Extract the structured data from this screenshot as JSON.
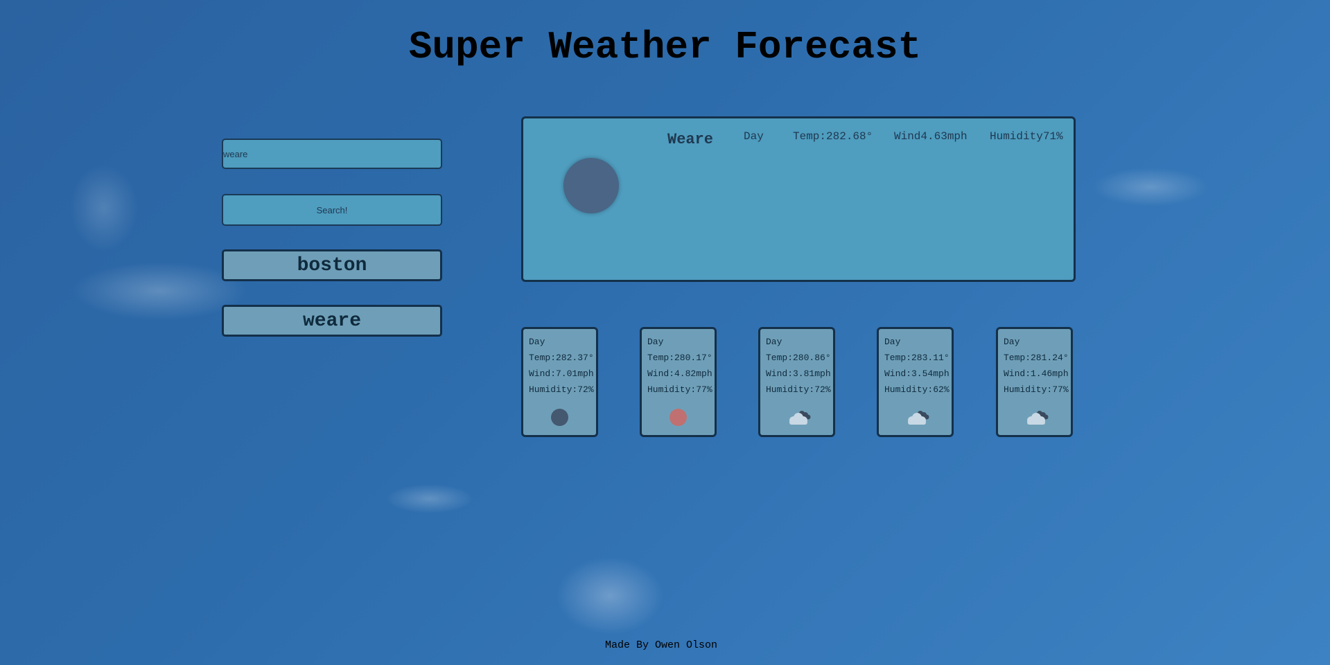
{
  "header": {
    "title": "Super Weather Forecast"
  },
  "search": {
    "value": "weare",
    "button_label": "Search!"
  },
  "history": [
    {
      "label": "boston"
    },
    {
      "label": "weare"
    }
  ],
  "current": {
    "city": "Weare",
    "day": "Day",
    "temp": "Temp:282.68°",
    "wind": "Wind4.63mph",
    "humidity": "Humidity71%",
    "icon": "dark-moon-icon",
    "icon_color": "#4a6585"
  },
  "forecast": [
    {
      "day": "Day",
      "temp": "Temp:282.37°",
      "wind": "Wind:7.01mph",
      "humidity": "Humidity:72%",
      "icon": "dark-moon-icon",
      "icon_color": "#44586f"
    },
    {
      "day": "Day",
      "temp": "Temp:280.17°",
      "wind": "Wind:4.82mph",
      "humidity": "Humidity:77%",
      "icon": "red-sun-icon",
      "icon_color": "#c07070"
    },
    {
      "day": "Day",
      "temp": "Temp:280.86°",
      "wind": "Wind:3.81mph",
      "humidity": "Humidity:72%",
      "icon": "cloudy-night-icon"
    },
    {
      "day": "Day",
      "temp": "Temp:283.11°",
      "wind": "Wind:3.54mph",
      "humidity": "Humidity:62%",
      "icon": "cloudy-night-icon"
    },
    {
      "day": "Day",
      "temp": "Temp:281.24°",
      "wind": "Wind:1.46mph",
      "humidity": "Humidity:77%",
      "icon": "cloudy-night-icon"
    }
  ],
  "footer": {
    "text": "Made By Owen Olson"
  },
  "colors": {
    "panel": "#4f9dbf",
    "card": "#6f9fb8",
    "border": "#14304a",
    "sky": "#2d6cac"
  }
}
